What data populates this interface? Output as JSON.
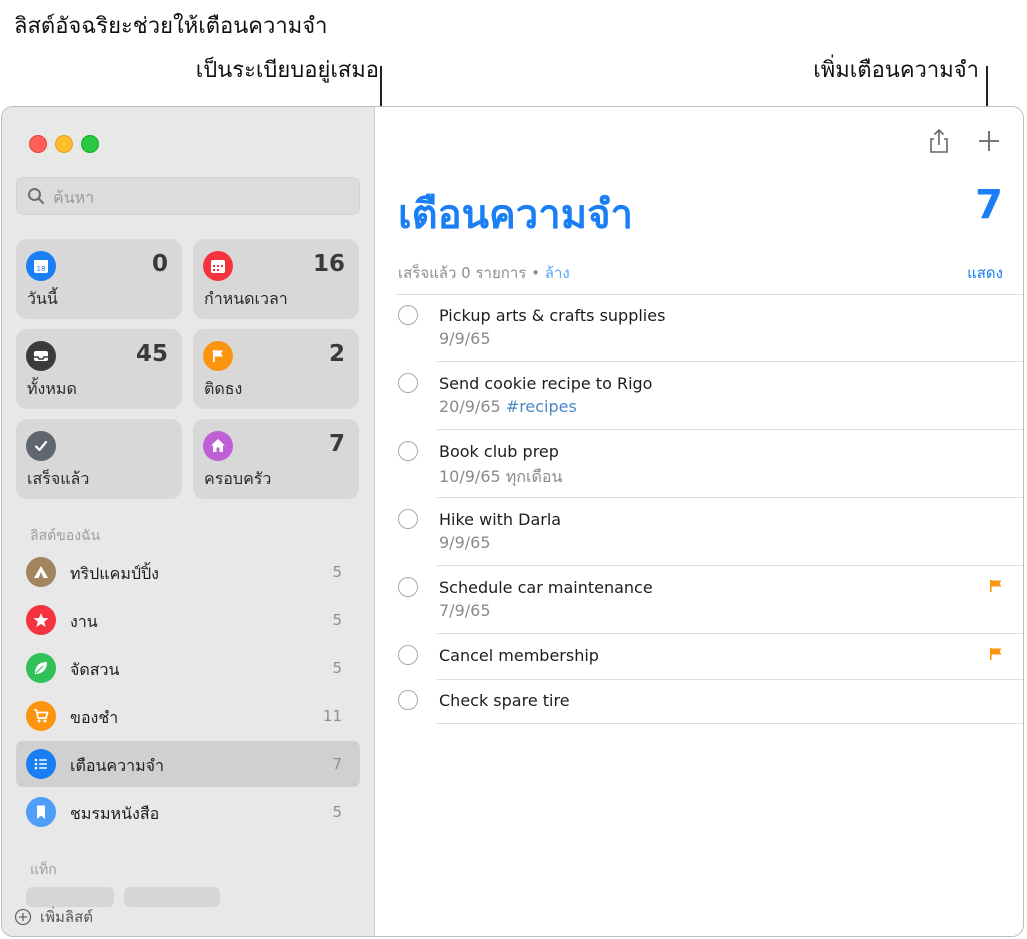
{
  "callouts": {
    "smart_lists_line1": "ลิสต์อัจฉริยะช่วยให้เตือนความจำ",
    "smart_lists_line2": "เป็นระเบียบอยู่เสมอ",
    "add_reminder": "เพิ่มเตือนความจำ"
  },
  "sidebar": {
    "search_placeholder": "ค้นหา",
    "smart_lists": [
      {
        "label": "วันนี้",
        "count": "0",
        "icon": "calendar-today-icon",
        "color": "#1a7ef5"
      },
      {
        "label": "กำหนดเวลา",
        "count": "16",
        "icon": "calendar-scheduled-icon",
        "color": "#f5333f"
      },
      {
        "label": "ทั้งหมด",
        "count": "45",
        "icon": "tray-icon",
        "color": "#3b3b3b"
      },
      {
        "label": "ติดธง",
        "count": "2",
        "icon": "flag-icon",
        "color": "#fd9410"
      },
      {
        "label": "เสร็จแล้ว",
        "count": "",
        "icon": "checkmark-icon",
        "color": "#5f666d"
      },
      {
        "label": "ครอบครัว",
        "count": "7",
        "icon": "house-icon",
        "color": "#bf5fd6"
      }
    ],
    "my_lists_header": "ลิสต์ของฉัน",
    "my_lists": [
      {
        "name": "ทริปแคมป์ปิ้ง",
        "count": "5",
        "icon": "tent-icon",
        "color": "#a2845e"
      },
      {
        "name": "งาน",
        "count": "5",
        "icon": "star-icon",
        "color": "#f5333f"
      },
      {
        "name": "จัดสวน",
        "count": "5",
        "icon": "leaf-icon",
        "color": "#30c158"
      },
      {
        "name": "ของชำ",
        "count": "11",
        "icon": "cart-icon",
        "color": "#fd9410"
      },
      {
        "name": "เตือนความจำ",
        "count": "7",
        "icon": "list-bullet-icon",
        "color": "#1a7ef5"
      },
      {
        "name": "ชมรมหนังสือ",
        "count": "5",
        "icon": "bookmark-icon",
        "color": "#4f9ef8"
      }
    ],
    "tags_header": "แท็ก",
    "add_list_label": "เพิ่มลิสต์"
  },
  "main": {
    "title": "เตือนความจำ",
    "total": "7",
    "completed_text": "เสร็จแล้ว 0 รายการ",
    "bullet": "•",
    "clear_label": "ล้าง",
    "show_label": "แสดง",
    "items": [
      {
        "title": "Pickup arts & crafts supplies",
        "date": "9/9/65",
        "tag": "",
        "flagged": false
      },
      {
        "title": "Send cookie recipe to Rigo",
        "date": "20/9/65",
        "tag": "#recipes",
        "flagged": false
      },
      {
        "title": "Book club prep",
        "date": "10/9/65 ทุกเดือน",
        "tag": "",
        "flagged": false
      },
      {
        "title": "Hike with Darla",
        "date": "9/9/65",
        "tag": "",
        "flagged": false
      },
      {
        "title": "Schedule car maintenance",
        "date": "7/9/65",
        "tag": "",
        "flagged": true
      },
      {
        "title": "Cancel membership",
        "date": "",
        "tag": "",
        "flagged": true
      },
      {
        "title": "Check spare tire",
        "date": "",
        "tag": "",
        "flagged": false
      }
    ]
  },
  "colors": {
    "accent": "#1a7ef5",
    "flag": "#fd9410",
    "tag": "#4f86c6"
  }
}
